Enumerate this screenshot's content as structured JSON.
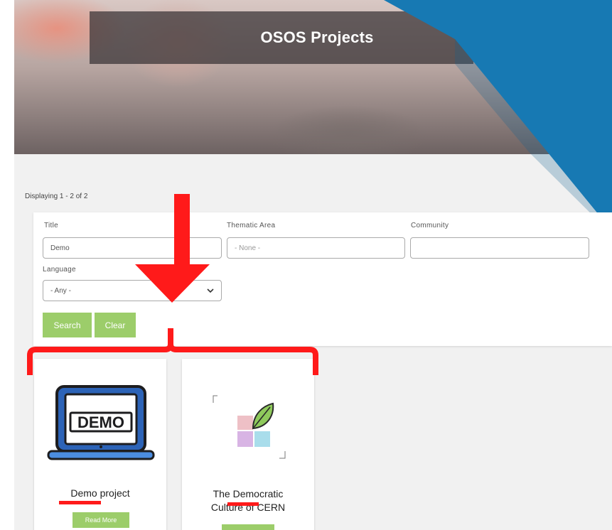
{
  "header": {
    "title": "OSOS Projects"
  },
  "results": {
    "summary": "Displaying 1 - 2 of 2"
  },
  "filters": {
    "title_label": "Title",
    "title_value": "Demo",
    "thematic_label": "Thematic Area",
    "thematic_value": "- None -",
    "community_label": "Community",
    "community_value": "",
    "language_label": "Language",
    "language_value": "- Any -",
    "search_label": "Search",
    "clear_label": "Clear"
  },
  "cards": [
    {
      "title": "Demo project",
      "image_text": "DEMO",
      "button": "Read More"
    },
    {
      "title_line1": "The Democratic",
      "title_line2": "Culture of CERN",
      "button": ""
    }
  ],
  "colors": {
    "accent_green": "#9ccd6a",
    "blue_band": "#1779b3",
    "annotation_red": "#ff1a1a"
  },
  "icons": [
    "chevron-down-icon",
    "laptop-demo-icon",
    "leaf-squares-logo-icon",
    "down-arrow-annotation-icon"
  ]
}
